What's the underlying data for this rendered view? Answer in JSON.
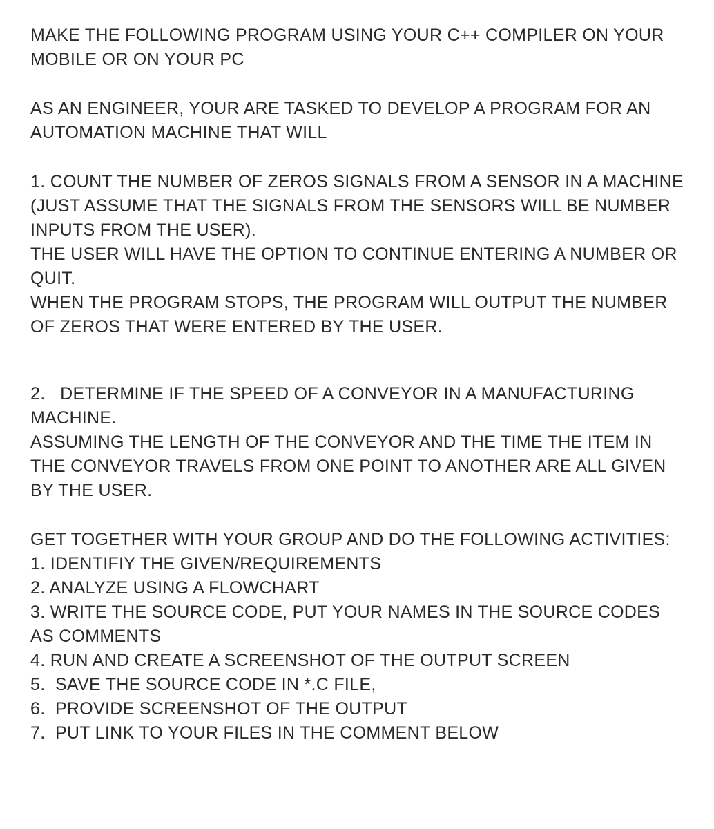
{
  "intro": {
    "p1": "MAKE THE FOLLOWING PROGRAM USING YOUR C++ COMPILER ON YOUR MOBILE OR ON YOUR PC",
    "p2": "AS AN ENGINEER, YOUR ARE TASKED TO DEVELOP A PROGRAM FOR AN AUTOMATION MACHINE THAT WILL"
  },
  "task1": {
    "heading": "1. COUNT THE NUMBER OF ZEROS SIGNALS FROM A SENSOR IN A MACHINE",
    "note": "(JUST ASSUME THAT THE SIGNALS FROM THE SENSORS WILL BE NUMBER INPUTS FROM THE USER).",
    "line1": "THE USER WILL HAVE THE OPTION TO CONTINUE ENTERING A NUMBER OR QUIT.",
    "line2": "WHEN THE PROGRAM STOPS, THE PROGRAM WILL OUTPUT THE NUMBER OF ZEROS THAT WERE ENTERED BY THE USER."
  },
  "task2": {
    "heading": "2.   DETERMINE IF THE SPEED OF A CONVEYOR IN A MANUFACTURING MACHINE.",
    "detail": "ASSUMING THE LENGTH OF THE CONVEYOR AND THE TIME THE ITEM IN THE CONVEYOR TRAVELS FROM ONE POINT TO ANOTHER ARE ALL GIVEN BY THE USER."
  },
  "activities": {
    "header": "GET TOGETHER WITH YOUR GROUP AND DO THE FOLLOWING ACTIVITIES:",
    "items": [
      "1. IDENTIFIY THE GIVEN/REQUIREMENTS",
      "2. ANALYZE USING A FLOWCHART",
      "3. WRITE THE SOURCE CODE, PUT YOUR NAMES IN THE SOURCE CODES AS COMMENTS",
      "4. RUN AND CREATE A SCREENSHOT OF THE OUTPUT SCREEN",
      "5.  SAVE THE SOURCE CODE IN *.C FILE,",
      "6.  PROVIDE SCREENSHOT OF THE OUTPUT",
      "7.  PUT LINK TO YOUR FILES IN THE COMMENT BELOW"
    ]
  }
}
